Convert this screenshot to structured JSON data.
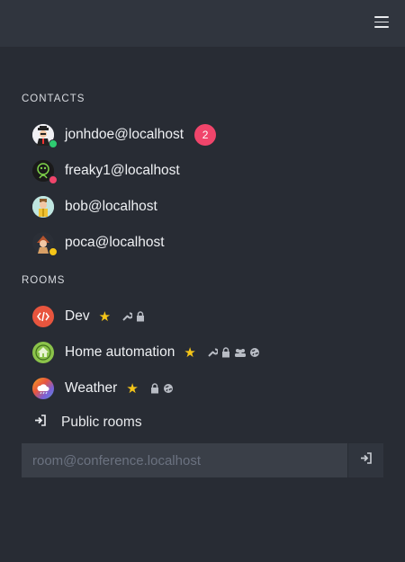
{
  "header": {
    "menu_icon": "hamburger-menu-icon"
  },
  "contacts": {
    "title": "CONTACTS",
    "items": [
      {
        "name": "jonhdoe@localhost",
        "status": "online",
        "status_color": "#2ecc71",
        "badge": "2"
      },
      {
        "name": "freaky1@localhost",
        "status": "busy",
        "status_color": "#f0456b"
      },
      {
        "name": "bob@localhost",
        "status": "none"
      },
      {
        "name": "poca@localhost",
        "status": "away",
        "status_color": "#f5c518"
      }
    ]
  },
  "rooms": {
    "title": "ROOMS",
    "items": [
      {
        "name": "Dev",
        "icon": "code-icon",
        "icon_color": "#e8553e",
        "favorite": true,
        "features": [
          "wrench-icon",
          "lock-icon"
        ]
      },
      {
        "name": "Home automation",
        "icon": "home-icon",
        "icon_color": "#8bc34a",
        "favorite": true,
        "features": [
          "wrench-icon",
          "lock-icon",
          "group-icon",
          "globe-icon"
        ]
      },
      {
        "name": "Weather",
        "icon": "weather-icon",
        "icon_color": "#5b8fd6",
        "favorite": true,
        "features": [
          "lock-icon",
          "globe-icon"
        ]
      }
    ],
    "public_rooms_label": "Public rooms"
  },
  "join": {
    "placeholder": "room@conference.localhost"
  }
}
